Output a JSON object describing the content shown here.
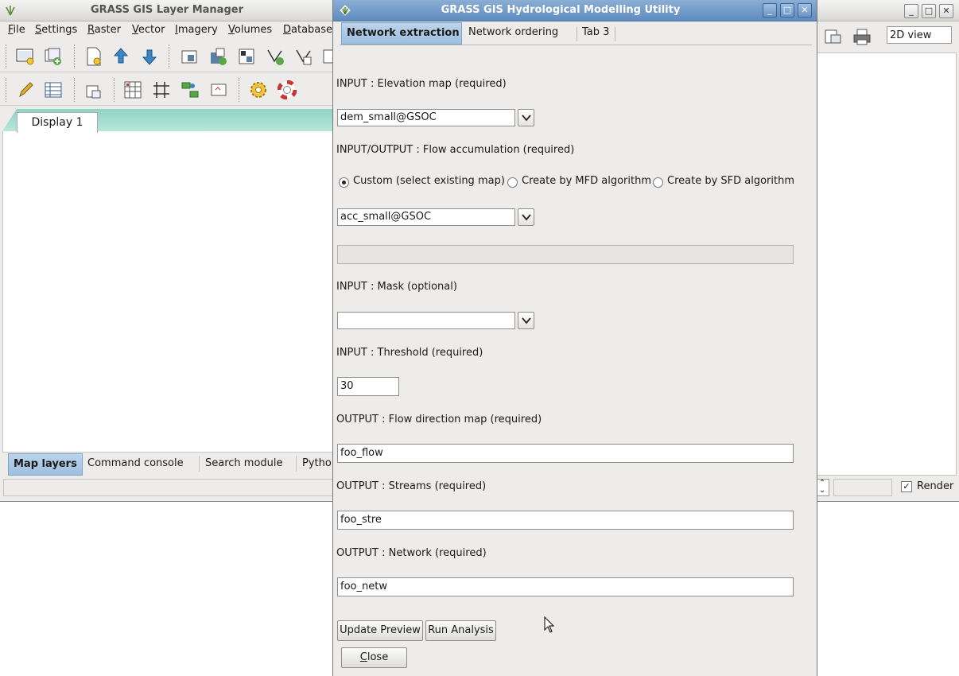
{
  "layer_manager": {
    "title": "GRASS GIS Layer Manager",
    "menu": [
      {
        "u": "F",
        "rest": "ile"
      },
      {
        "u": "S",
        "rest": "ettings"
      },
      {
        "u": "R",
        "rest": "aster"
      },
      {
        "u": "V",
        "rest": "ector"
      },
      {
        "u": "I",
        "rest": "magery"
      },
      {
        "u": "V",
        "rest": "olumes"
      },
      {
        "u": "D",
        "rest": "atabase"
      }
    ],
    "display_tab": "Display 1",
    "bottom_tabs": [
      "Map layers",
      "Command console",
      "Search module",
      "Pytho"
    ]
  },
  "map_display": {
    "view_mode": "2D view",
    "render_label": "Render",
    "render_checked": "✓"
  },
  "dialog": {
    "title": "GRASS GIS Hydrological Modelling Utility",
    "tabs": [
      "Network extraction",
      "Network ordering",
      "Tab 3"
    ],
    "elevation": {
      "label": "INPUT : Elevation map (required)",
      "value": "dem_small@GSOC"
    },
    "flow_acc": {
      "label": "INPUT/OUTPUT : Flow accumulation (required)",
      "options": [
        "Custom (select existing map)",
        "Create by MFD algorithm",
        "Create by SFD algorithm"
      ],
      "selected_index": 0,
      "value": "acc_small@GSOC"
    },
    "mask": {
      "label": "INPUT : Mask (optional)",
      "value": ""
    },
    "threshold": {
      "label": "INPUT : Threshold (required)",
      "value": "30"
    },
    "flow_dir": {
      "label": "OUTPUT : Flow direction map (required)",
      "value": "foo_flow"
    },
    "streams": {
      "label": "OUTPUT : Streams (required)",
      "value": "foo_stre"
    },
    "network": {
      "label": "OUTPUT : Network (required)",
      "value": "foo_netw"
    },
    "buttons": {
      "update_preview": "Update Preview",
      "run_analysis": "Run Analysis",
      "close_u": "C",
      "close_rest": "lose"
    },
    "accent_color": "#7da3c9"
  }
}
